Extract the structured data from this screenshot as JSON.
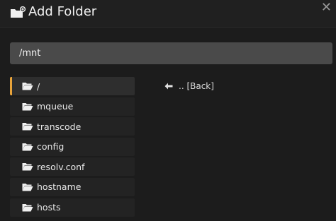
{
  "dialog": {
    "title": "Add Folder",
    "close_label": "✕"
  },
  "path_input": {
    "value": "/mnt"
  },
  "folders": [
    {
      "label": "/"
    },
    {
      "label": "mqueue"
    },
    {
      "label": "transcode"
    },
    {
      "label": "config"
    },
    {
      "label": "resolv.conf"
    },
    {
      "label": "hostname"
    },
    {
      "label": "hosts"
    }
  ],
  "back": {
    "label": ".. [Back]"
  },
  "colors": {
    "background": "#1c1c1c",
    "selected_accent": "#e8a33a",
    "input_bg": "#4a4a4a"
  }
}
